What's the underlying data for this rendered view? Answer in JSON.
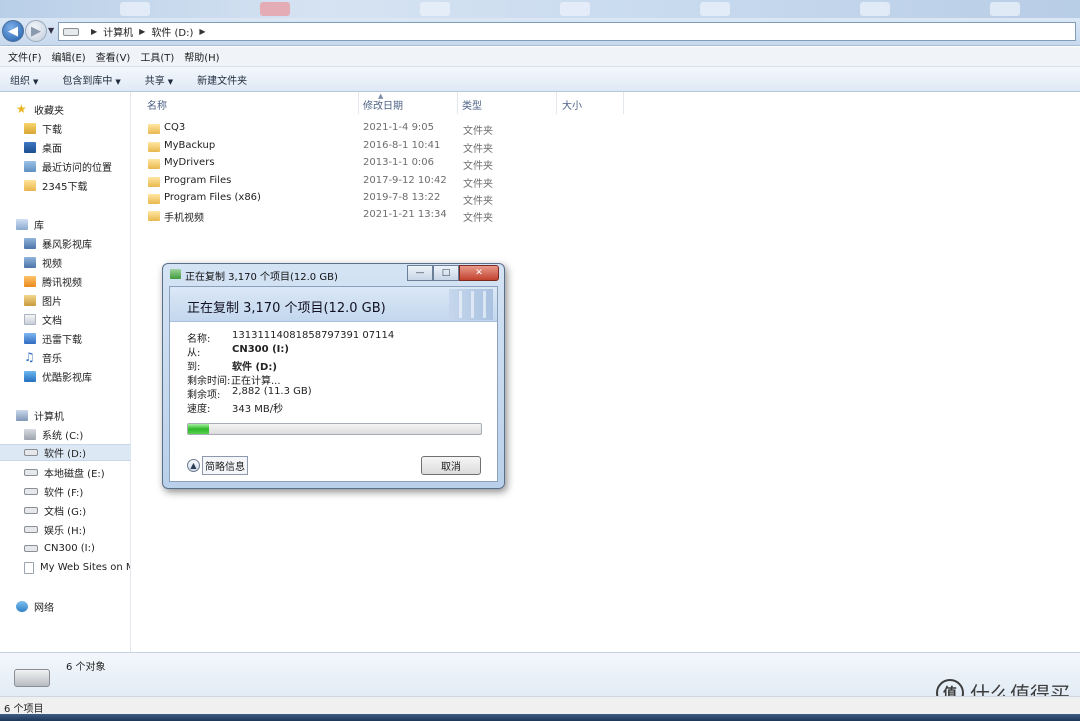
{
  "breadcrumb": [
    "计算机",
    "软件 (D:)"
  ],
  "menu": [
    "文件(F)",
    "编辑(E)",
    "查看(V)",
    "工具(T)",
    "帮助(H)"
  ],
  "commands": [
    "组织",
    "包含到库中",
    "共享",
    "新建文件夹"
  ],
  "nav": {
    "favorites": {
      "label": "收藏夹",
      "items": [
        "下载",
        "桌面",
        "最近访问的位置",
        "2345下载"
      ]
    },
    "libraries": {
      "label": "库",
      "items": [
        "暴风影视库",
        "视频",
        "腾讯视频",
        "图片",
        "文档",
        "迅雷下载",
        "音乐",
        "优酷影视库"
      ]
    },
    "computer": {
      "label": "计算机",
      "items": [
        "系统 (C:)",
        "软件 (D:)",
        "本地磁盘 (E:)",
        "软件 (F:)",
        "文档 (G:)",
        "娱乐 (H:)",
        "CN300 (I:)",
        "My Web Sites on M"
      ]
    },
    "network": {
      "label": "网络"
    }
  },
  "columns": {
    "name": "名称",
    "date": "修改日期",
    "type": "类型",
    "size": "大小"
  },
  "files": [
    {
      "name": "CQ3",
      "date": "2021-1-4 9:05",
      "type": "文件夹"
    },
    {
      "name": "MyBackup",
      "date": "2016-8-1 10:41",
      "type": "文件夹"
    },
    {
      "name": "MyDrivers",
      "date": "2013-1-1 0:06",
      "type": "文件夹"
    },
    {
      "name": "Program Files",
      "date": "2017-9-12 10:42",
      "type": "文件夹"
    },
    {
      "name": "Program Files (x86)",
      "date": "2019-7-8 13:22",
      "type": "文件夹"
    },
    {
      "name": "手机视频",
      "date": "2021-1-21 13:34",
      "type": "文件夹"
    }
  ],
  "dialog": {
    "title": "正在复制 3,170 个项目(12.0 GB)",
    "header": "正在复制 3,170 个项目(12.0 GB)",
    "labels": {
      "name": "名称:",
      "from": "从:",
      "to": "到:",
      "time": "剩余时间:",
      "items": "剩余项:",
      "speed": "速度:"
    },
    "values": {
      "name": "13131114081858797391 07114",
      "from": "CN300 (I:)",
      "to": "软件 (D:)",
      "time": "正在计算...",
      "items": "2,882 (11.3 GB)",
      "speed": "343 MB/秒"
    },
    "progress_percent": 7,
    "more_label": "简略信息",
    "cancel_label": "取消"
  },
  "details": {
    "count": "6 个对象"
  },
  "status": {
    "text": "6 个项目"
  },
  "watermark": {
    "logo": "值",
    "text": "什么值得买"
  }
}
